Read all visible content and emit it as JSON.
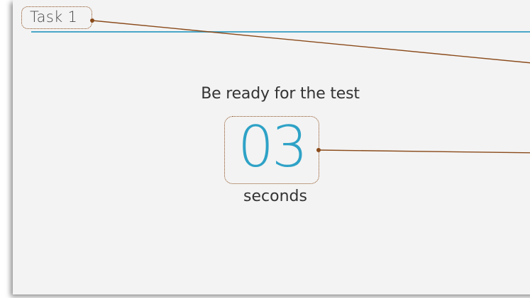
{
  "task": {
    "title": "Task 1"
  },
  "countdown": {
    "prompt": "Be ready for the test",
    "value": "03",
    "unit": "seconds"
  },
  "colors": {
    "accent": "#2ea2c6",
    "header_line": "#4aa7c8",
    "callout": "#8a4a1a",
    "panel_background": "#f3f3f3"
  }
}
